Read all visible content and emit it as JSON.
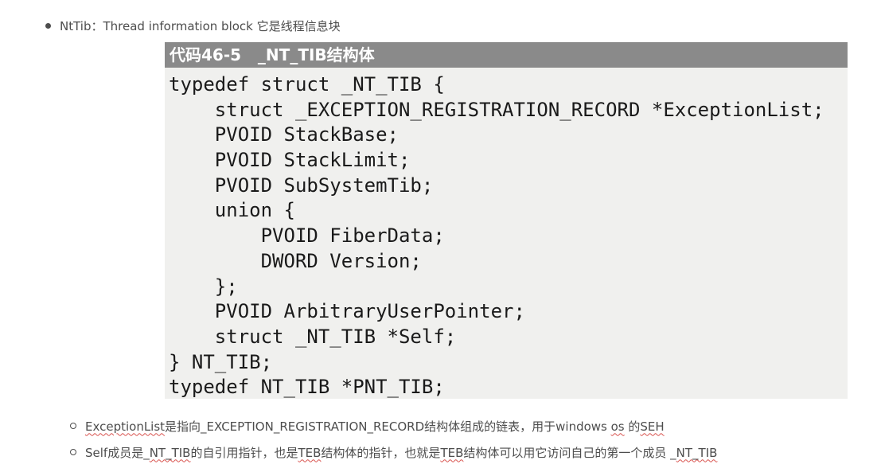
{
  "top_item": {
    "label": "NtTib：Thread information block 它是线程信息块"
  },
  "figure": {
    "caption": "代码46-5   _NT_TIB结构体",
    "code_lines": [
      "typedef struct _NT_TIB {",
      "    struct _EXCEPTION_REGISTRATION_RECORD *ExceptionList;",
      "    PVOID StackBase;",
      "    PVOID StackLimit;",
      "    PVOID SubSystemTib;",
      "    union {",
      "        PVOID FiberData;",
      "        DWORD Version;",
      "    };",
      "    PVOID ArbitraryUserPointer;",
      "    struct _NT_TIB *Self;",
      "} NT_TIB;",
      "typedef NT_TIB *PNT_TIB;"
    ]
  },
  "sub_items": [
    {
      "segments": [
        {
          "text": "ExceptionList",
          "squiggle": true
        },
        {
          "text": "是指向_EXCEPTION_REGISTRATION_RECORD结构体组成的链表，用于windows ",
          "squiggle": false
        },
        {
          "text": "os",
          "squiggle": true
        },
        {
          "text": " 的",
          "squiggle": false
        },
        {
          "text": "SEH",
          "squiggle": true
        }
      ]
    },
    {
      "segments": [
        {
          "text": "Self成员是_",
          "squiggle": false
        },
        {
          "text": "NT_TIB",
          "squiggle": true
        },
        {
          "text": "的自引用指针，也是",
          "squiggle": false
        },
        {
          "text": "TEB",
          "squiggle": true
        },
        {
          "text": "结构体的指针，也就是",
          "squiggle": false
        },
        {
          "text": "TEB",
          "squiggle": true
        },
        {
          "text": "结构体可以用它访问自己的第一个成员 _",
          "squiggle": false
        },
        {
          "text": "NT_TIB",
          "squiggle": true
        }
      ]
    }
  ]
}
